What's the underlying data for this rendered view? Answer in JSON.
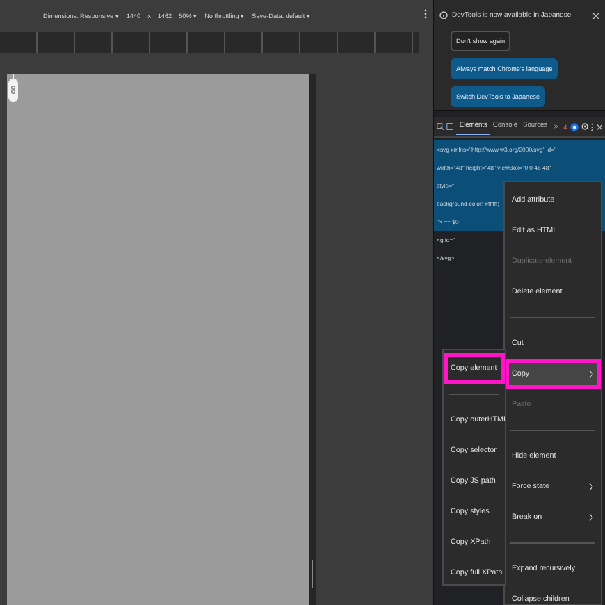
{
  "toolbar": {
    "items": [
      "Dimensions: Responsive ▾",
      "1440",
      "x",
      "1462",
      "50% ▾",
      "No throttling ▾",
      "Save-Data: default ▾"
    ]
  },
  "infobar": {
    "message": "DevTools is now available in Japanese",
    "buttons": [
      {
        "label": "Don't show again",
        "kind": "secondary"
      },
      {
        "label": "Always match Chrome's language",
        "kind": "primary"
      },
      {
        "label": "Switch DevTools to Japanese",
        "kind": "primary"
      }
    ]
  },
  "tabs": [
    {
      "label": "Elements",
      "selected": true
    },
    {
      "label": "Console",
      "selected": false
    },
    {
      "label": "Sources",
      "selected": false
    }
  ],
  "issues_badge": "4",
  "dom_lines": [
    {
      "text": "<svg xmlns=\"http://www.w3.org/2000/svg\" id=\"",
      "selected": true
    },
    {
      "text": "width=\"48\" height=\"48\" viewBox=\"0 0 48 48\"",
      "selected": true
    },
    {
      "text": "style=\"",
      "selected": true
    },
    {
      "text": "background-color: #ffffff;",
      "selected": true
    },
    {
      "text": "\"> == $0",
      "selected": true
    },
    {
      "text": "<g id=\"",
      "selected": false
    },
    {
      "text": "</svg>",
      "selected": false
    }
  ],
  "context_menu": {
    "items": [
      {
        "kind": "item",
        "label": "Add attribute",
        "disabled": false,
        "hovered": false,
        "annotated": false,
        "submenu": false
      },
      {
        "kind": "item",
        "label": "Edit as HTML",
        "disabled": false,
        "hovered": false,
        "annotated": false,
        "submenu": false
      },
      {
        "kind": "item",
        "label": "Duplicate element",
        "disabled": true,
        "hovered": false,
        "annotated": false,
        "submenu": false
      },
      {
        "kind": "item",
        "label": "Delete element",
        "disabled": false,
        "hovered": false,
        "annotated": false,
        "submenu": false
      },
      {
        "kind": "separator"
      },
      {
        "kind": "item",
        "label": "Cut",
        "disabled": false,
        "hovered": false,
        "annotated": false,
        "submenu": false
      },
      {
        "kind": "item",
        "label": "Copy",
        "disabled": false,
        "hovered": true,
        "annotated": true,
        "submenu": true
      },
      {
        "kind": "item",
        "label": "Paste",
        "disabled": true,
        "hovered": false,
        "annotated": false,
        "submenu": false
      },
      {
        "kind": "separator"
      },
      {
        "kind": "item",
        "label": "Hide element",
        "disabled": false,
        "hovered": false,
        "annotated": false,
        "submenu": false
      },
      {
        "kind": "item",
        "label": "Force state",
        "disabled": false,
        "hovered": false,
        "annotated": false,
        "submenu": true
      },
      {
        "kind": "item",
        "label": "Break on",
        "disabled": false,
        "hovered": false,
        "annotated": false,
        "submenu": true
      },
      {
        "kind": "separator"
      },
      {
        "kind": "item",
        "label": "Expand recursively",
        "disabled": false,
        "hovered": false,
        "annotated": false,
        "submenu": false
      },
      {
        "kind": "item",
        "label": "Collapse children",
        "disabled": false,
        "hovered": false,
        "annotated": false,
        "submenu": false
      }
    ]
  },
  "copy_submenu": {
    "items": [
      {
        "kind": "item",
        "label": "Copy element",
        "annotated": true
      },
      {
        "kind": "separator"
      },
      {
        "kind": "item",
        "label": "Copy outerHTML",
        "annotated": false
      },
      {
        "kind": "item",
        "label": "Copy selector",
        "annotated": false
      },
      {
        "kind": "item",
        "label": "Copy JS path",
        "annotated": false
      },
      {
        "kind": "item",
        "label": "Copy styles",
        "annotated": false
      },
      {
        "kind": "item",
        "label": "Copy XPath",
        "annotated": false
      },
      {
        "kind": "item",
        "label": "Copy full XPath",
        "annotated": false
      }
    ]
  }
}
